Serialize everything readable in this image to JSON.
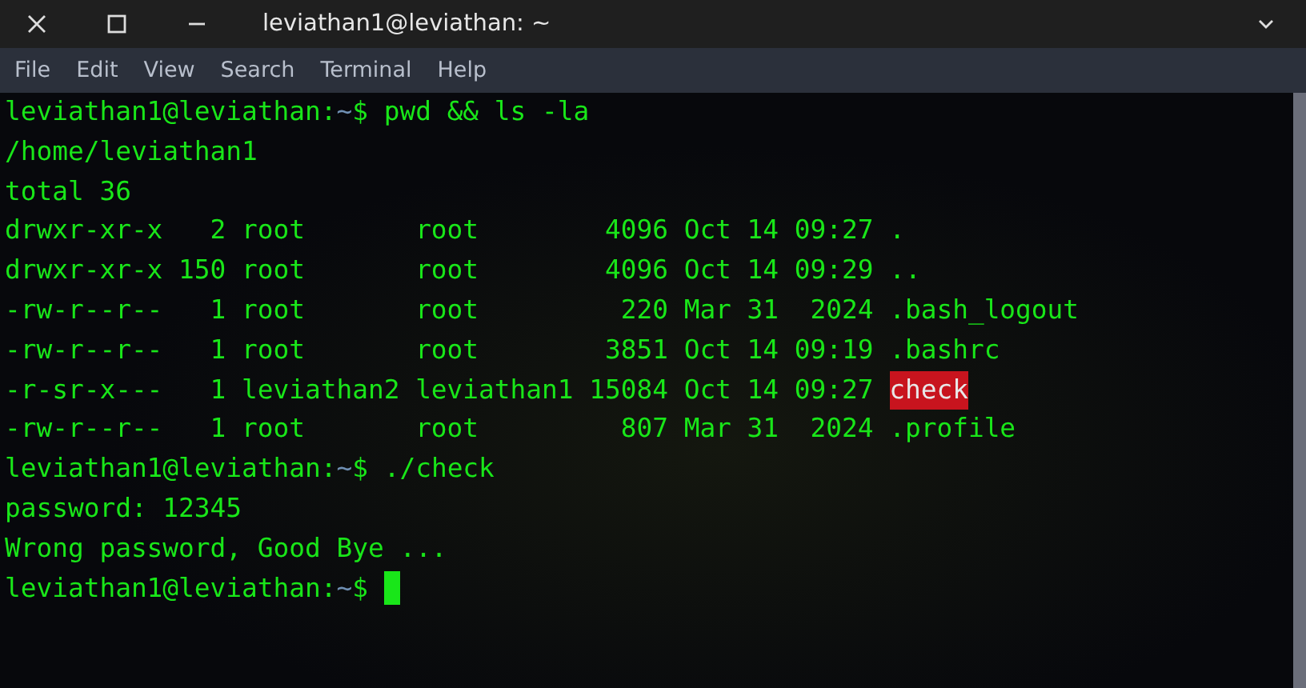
{
  "window": {
    "title": "leviathan1@leviathan: ~"
  },
  "menu": [
    "File",
    "Edit",
    "View",
    "Search",
    "Terminal",
    "Help"
  ],
  "terminal": {
    "lines": [
      {
        "kind": "prompt",
        "user_host": "leviathan1@leviathan:",
        "path": "~",
        "command": "$ pwd && ls -la",
        "cursor": false
      },
      {
        "kind": "output",
        "text": "/home/leviathan1"
      },
      {
        "kind": "output",
        "text": "total 36"
      },
      {
        "kind": "listing",
        "info": "drwxr-xr-x   2 root       root        4096 Oct 14 09:27",
        "name": ".",
        "highlight": false
      },
      {
        "kind": "listing",
        "info": "drwxr-xr-x 150 root       root        4096 Oct 14 09:29",
        "name": "..",
        "highlight": false
      },
      {
        "kind": "listing",
        "info": "-rw-r--r--   1 root       root         220 Mar 31  2024",
        "name": ".bash_logout",
        "highlight": false
      },
      {
        "kind": "listing",
        "info": "-rw-r--r--   1 root       root        3851 Oct 14 09:19",
        "name": ".bashrc",
        "highlight": false
      },
      {
        "kind": "listing",
        "info": "-r-sr-x---   1 leviathan2 leviathan1 15084 Oct 14 09:27",
        "name": "check",
        "highlight": true
      },
      {
        "kind": "listing",
        "info": "-rw-r--r--   1 root       root         807 Mar 31  2024",
        "name": ".profile",
        "highlight": false
      },
      {
        "kind": "prompt",
        "user_host": "leviathan1@leviathan:",
        "path": "~",
        "command": "$ ./check",
        "cursor": false
      },
      {
        "kind": "output",
        "text": "password: 12345"
      },
      {
        "kind": "output",
        "text": "Wrong password, Good Bye ..."
      },
      {
        "kind": "prompt",
        "user_host": "leviathan1@leviathan:",
        "path": "~",
        "command": "$",
        "cursor": true
      }
    ]
  }
}
